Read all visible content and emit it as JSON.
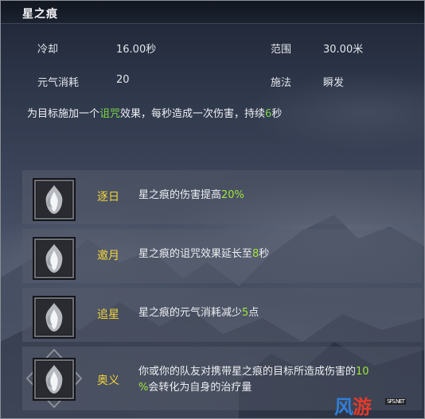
{
  "skill": {
    "title": "星之痕",
    "cooldown_label": "冷却",
    "cooldown_value": "16.00秒",
    "range_label": "范围",
    "range_value": "30.00米",
    "cost_label": "元气消耗",
    "cost_value": "20",
    "cast_label": "施法",
    "cast_value": "瞬发",
    "description": {
      "part1": "为目标施加一个",
      "keyword": "诅咒",
      "part2": "效果，每秒造成一次伤害，持续",
      "duration": "6",
      "part3": "秒"
    }
  },
  "talents": [
    {
      "name": "逐日",
      "desc_text": "星之痕的伤害提高",
      "desc_value": "20%",
      "desc_suffix": ""
    },
    {
      "name": "邀月",
      "desc_text": "星之痕的诅咒效果延长至",
      "desc_value": "8",
      "desc_suffix": "秒"
    },
    {
      "name": "追星",
      "desc_text": "星之痕的元气消耗减少",
      "desc_value": "5",
      "desc_suffix": "点"
    },
    {
      "name": "奥义",
      "desc_line1": "你或你的队友对携带星之痕的目标所造成伤害的",
      "desc_value_a": "10",
      "desc_value_b": "%",
      "desc_line2": "会转化为自身的治疗量"
    }
  ],
  "watermark": {
    "part1": "风",
    "part2": "游",
    "site": "SFS.NET"
  },
  "colors": {
    "talent_name": "#f2d43a",
    "highlight": "#7bd84a",
    "title_bar": "#11161f"
  },
  "icons": [
    "flame-talent-icon",
    "flame-talent-icon",
    "flame-talent-icon",
    "flame-talent-icon"
  ]
}
